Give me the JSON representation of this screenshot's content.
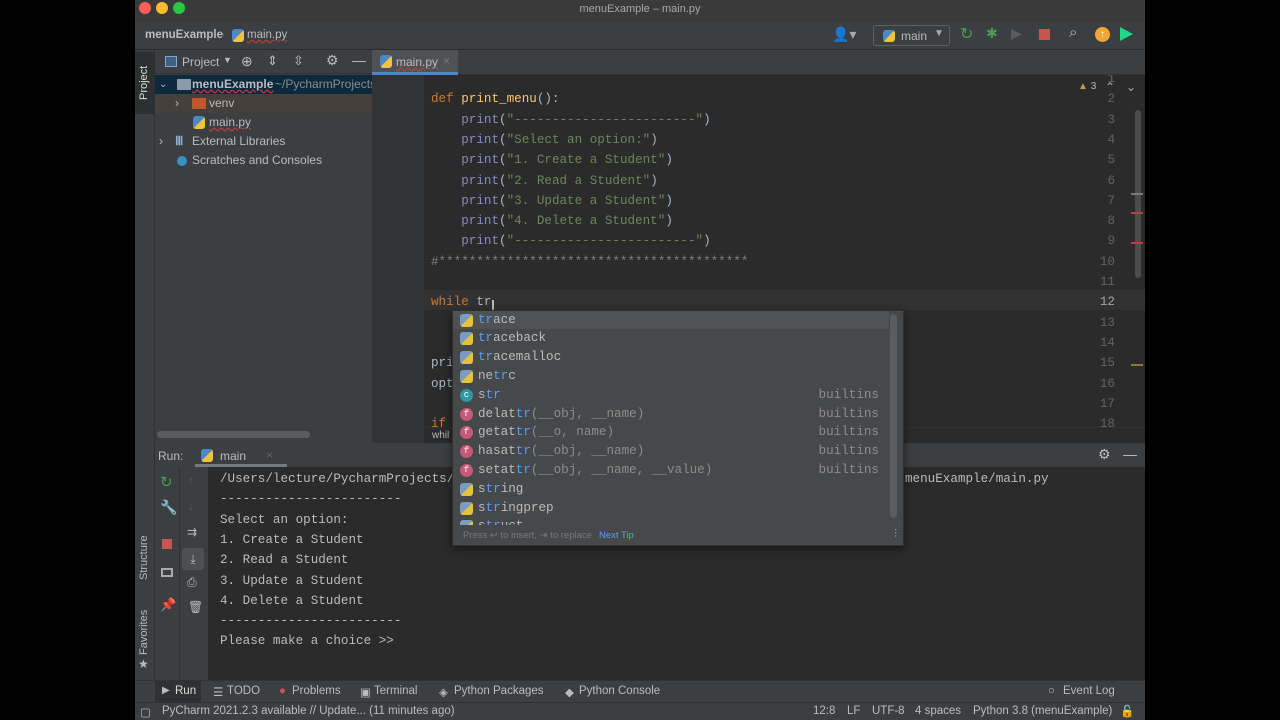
{
  "window": {
    "title": "menuExample – main.py"
  },
  "navbar": {
    "project": "menuExample",
    "file": "main.py",
    "run_config": "main"
  },
  "project_panel": {
    "title": "Project",
    "tree": [
      {
        "label": "menuExample",
        "hint": "~/PycharmProjects"
      },
      {
        "label": "venv"
      },
      {
        "label": "main.py"
      },
      {
        "label": "External Libraries"
      },
      {
        "label": "Scratches and Consoles"
      }
    ]
  },
  "side_stripe": {
    "project": "Project",
    "structure": "Structure",
    "favorites": "Favorites"
  },
  "editor": {
    "tab": "main.py",
    "warnings": "3",
    "breadcrumb": "whil",
    "lines": [
      {
        "n": "1",
        "tokens": []
      },
      {
        "n": "2",
        "tokens": [
          {
            "t": "def ",
            "c": "kw"
          },
          {
            "t": "print_menu",
            "c": "fn"
          },
          {
            "t": "():",
            "c": "pl"
          }
        ]
      },
      {
        "n": "3",
        "tokens": [
          {
            "t": "    print",
            "c": "bi"
          },
          {
            "t": "(",
            "c": "pl"
          },
          {
            "t": "\"------------------------\"",
            "c": "st"
          },
          {
            "t": ")",
            "c": "pl"
          }
        ]
      },
      {
        "n": "4",
        "tokens": [
          {
            "t": "    print",
            "c": "bi"
          },
          {
            "t": "(",
            "c": "pl"
          },
          {
            "t": "\"Select an option:\"",
            "c": "st"
          },
          {
            "t": ")",
            "c": "pl"
          }
        ]
      },
      {
        "n": "5",
        "tokens": [
          {
            "t": "    print",
            "c": "bi"
          },
          {
            "t": "(",
            "c": "pl"
          },
          {
            "t": "\"1. Create a Student\"",
            "c": "st"
          },
          {
            "t": ")",
            "c": "pl"
          }
        ]
      },
      {
        "n": "6",
        "tokens": [
          {
            "t": "    print",
            "c": "bi"
          },
          {
            "t": "(",
            "c": "pl"
          },
          {
            "t": "\"2. Read a Student\"",
            "c": "st"
          },
          {
            "t": ")",
            "c": "pl"
          }
        ]
      },
      {
        "n": "7",
        "tokens": [
          {
            "t": "    print",
            "c": "bi"
          },
          {
            "t": "(",
            "c": "pl"
          },
          {
            "t": "\"3. Update a Student\"",
            "c": "st"
          },
          {
            "t": ")",
            "c": "pl"
          }
        ]
      },
      {
        "n": "8",
        "tokens": [
          {
            "t": "    print",
            "c": "bi"
          },
          {
            "t": "(",
            "c": "pl"
          },
          {
            "t": "\"4. Delete a Student\"",
            "c": "st"
          },
          {
            "t": ")",
            "c": "pl"
          }
        ]
      },
      {
        "n": "9",
        "tokens": [
          {
            "t": "    print",
            "c": "bi"
          },
          {
            "t": "(",
            "c": "pl"
          },
          {
            "t": "\"------------------------\"",
            "c": "st"
          },
          {
            "t": ")",
            "c": "pl"
          }
        ]
      },
      {
        "n": "10",
        "tokens": [
          {
            "t": "#*****************************************",
            "c": "cm"
          }
        ]
      },
      {
        "n": "11",
        "tokens": []
      },
      {
        "n": "12",
        "tokens": [
          {
            "t": "while ",
            "c": "kw"
          },
          {
            "t": "tr",
            "c": "pl"
          }
        ]
      },
      {
        "n": "13",
        "tokens": []
      },
      {
        "n": "14",
        "tokens": []
      },
      {
        "n": "15",
        "tokens": [
          {
            "t": "pri",
            "c": "pl"
          }
        ]
      },
      {
        "n": "16",
        "tokens": [
          {
            "t": "opt",
            "c": "pl"
          }
        ]
      },
      {
        "n": "17",
        "tokens": []
      },
      {
        "n": "18",
        "tokens": [
          {
            "t": "if",
            "c": "kw"
          }
        ]
      }
    ]
  },
  "completion": {
    "items": [
      {
        "icon": "module",
        "pre": "",
        "match": "tr",
        "post": "ace",
        "args": "",
        "source": ""
      },
      {
        "icon": "module",
        "pre": "",
        "match": "tr",
        "post": "aceback",
        "args": "",
        "source": ""
      },
      {
        "icon": "module",
        "pre": "",
        "match": "tr",
        "post": "acemalloc",
        "args": "",
        "source": ""
      },
      {
        "icon": "module",
        "pre": "ne",
        "match": "tr",
        "post": "c",
        "args": "",
        "source": ""
      },
      {
        "icon": "class",
        "pre": "s",
        "match": "tr",
        "post": "",
        "args": "",
        "source": "builtins"
      },
      {
        "icon": "function",
        "pre": "delat",
        "match": "tr",
        "post": "",
        "args": "(__obj, __name)",
        "source": "builtins"
      },
      {
        "icon": "function",
        "pre": "getat",
        "match": "tr",
        "post": "",
        "args": "(__o, name)",
        "source": "builtins"
      },
      {
        "icon": "function",
        "pre": "hasat",
        "match": "tr",
        "post": "",
        "args": "(__obj, __name)",
        "source": "builtins"
      },
      {
        "icon": "function",
        "pre": "setat",
        "match": "tr",
        "post": "",
        "args": "(__obj, __name, __value)",
        "source": "builtins"
      },
      {
        "icon": "module",
        "pre": "s",
        "match": "tr",
        "post": "ing",
        "args": "",
        "source": ""
      },
      {
        "icon": "module",
        "pre": "s",
        "match": "tr",
        "post": "ingprep",
        "args": "",
        "source": ""
      },
      {
        "icon": "module",
        "pre": "s",
        "match": "tr",
        "post": "uct",
        "args": "",
        "source": ""
      }
    ],
    "hint": "Press ↩ to insert, ⇥ to replace",
    "next_tip": "Next Tip"
  },
  "run_panel": {
    "label": "Run:",
    "tab": "main",
    "path_start": "/Users/lecture/PycharmProjects/",
    "path_end": "menuExample/main.py",
    "output": [
      "------------------------",
      "Select an option:",
      "1. Create a Student",
      "2. Read a Student",
      "3. Update a Student",
      "4. Delete a Student",
      "------------------------",
      "Please make a choice >>"
    ]
  },
  "bottom_tools": [
    "Run",
    "TODO",
    "Problems",
    "Terminal",
    "Python Packages",
    "Python Console"
  ],
  "event_log": "Event Log",
  "status": {
    "message": "PyCharm 2021.2.3 available // Update... (11 minutes ago)",
    "position": "12:8",
    "line_sep": "LF",
    "encoding": "UTF-8",
    "indent": "4 spaces",
    "interpreter": "Python 3.8 (menuExample)"
  },
  "colors": {
    "accent": "#4a88c7",
    "run_green": "#499c54",
    "stop_red": "#c75450",
    "update_orange": "#f0a732"
  }
}
